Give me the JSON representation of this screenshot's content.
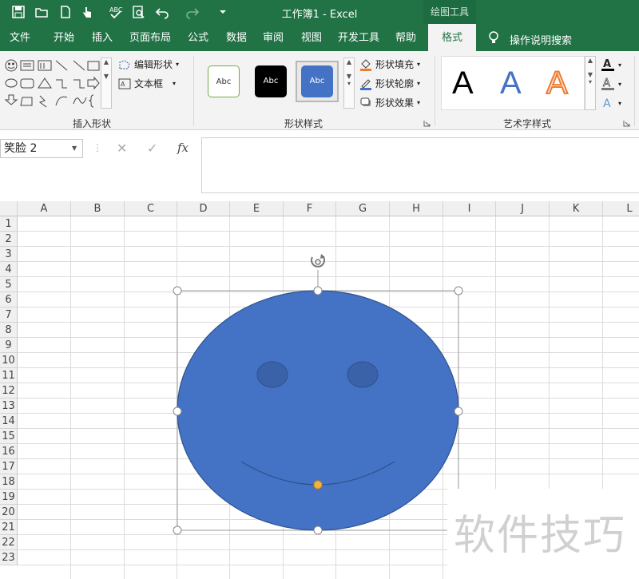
{
  "titlebar": {
    "title": "工作簿1  -  Excel",
    "context_label": "绘图工具"
  },
  "tabs": [
    {
      "label": "文件"
    },
    {
      "label": "开始"
    },
    {
      "label": "插入"
    },
    {
      "label": "页面布局"
    },
    {
      "label": "公式"
    },
    {
      "label": "数据"
    },
    {
      "label": "审阅"
    },
    {
      "label": "视图"
    },
    {
      "label": "开发工具"
    },
    {
      "label": "帮助"
    },
    {
      "label": "格式",
      "active": true
    }
  ],
  "tellme": "操作说明搜索",
  "ribbon": {
    "insert_shapes": {
      "label": "插入形状",
      "edit_shape": "编辑形状",
      "text_box": "文本框"
    },
    "shape_styles": {
      "label": "形状样式",
      "sample_text": "Abc",
      "fill": "形状填充",
      "outline": "形状轮廓",
      "effects": "形状效果"
    },
    "wordart": {
      "label": "艺术字样式",
      "sample": "A"
    }
  },
  "formula_bar": {
    "name_box": "笑脸 2",
    "cancel": "✕",
    "confirm": "✓",
    "fx": "fx",
    "content": ""
  },
  "columns": [
    "A",
    "B",
    "C",
    "D",
    "E",
    "F",
    "G",
    "H",
    "I",
    "J",
    "K",
    "L"
  ],
  "rows": [
    "1",
    "2",
    "3",
    "4",
    "5",
    "6",
    "7",
    "8",
    "9",
    "10",
    "11",
    "12",
    "13",
    "14",
    "15",
    "16",
    "17",
    "18",
    "19",
    "20",
    "21",
    "22",
    "23"
  ],
  "shape": {
    "name": "笑脸 2",
    "fill": "#4472c4",
    "stroke": "#2f528f",
    "eye_fill": "#3a62a8"
  },
  "watermark": "软件技巧",
  "colors": {
    "excel_green": "#217346",
    "ribbon_bg": "#f3f3f3"
  }
}
